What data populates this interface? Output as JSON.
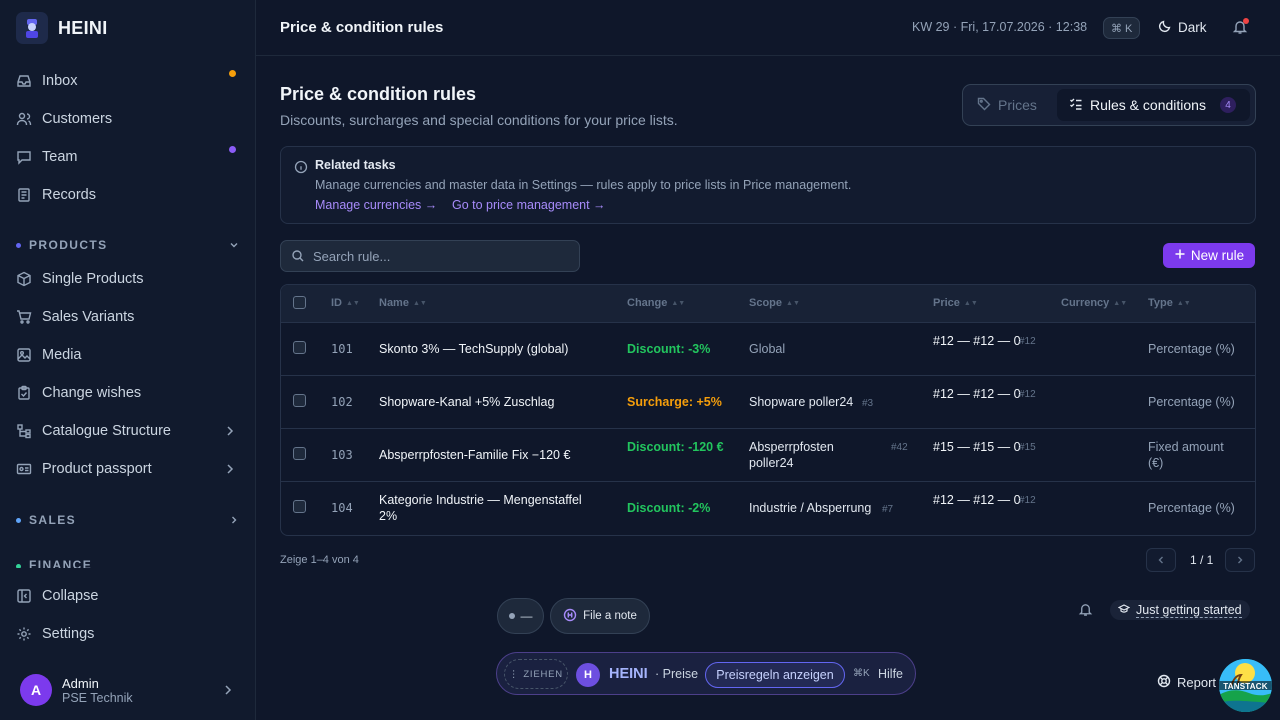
{
  "brand": {
    "name": "HEINI"
  },
  "nav": {
    "inbox": "Inbox",
    "customers": "Customers",
    "team": "Team",
    "records": "Records",
    "products_section": "PRODUCTS",
    "single_products": "Single Products",
    "sales_variants": "Sales Variants",
    "media": "Media",
    "change_wishes": "Change wishes",
    "catalogue_structure": "Catalogue Structure",
    "product_passport": "Product passport",
    "sales_section": "SALES",
    "finance_section": "FINANCE",
    "collapse": "Collapse",
    "settings": "Settings",
    "status_colors": {
      "inbox": "#f59e0b",
      "team": "#8b5cf6"
    }
  },
  "user": {
    "initial": "A",
    "name": "Admin",
    "org": "PSE Technik"
  },
  "topbar": {
    "title": "Price & condition rules",
    "datetime": "KW 29 · Fri, 17.07.2026 · 12:38",
    "shortcut": "⌘ K",
    "theme_label": "Dark"
  },
  "page": {
    "title": "Price & condition rules",
    "subtitle": "Discounts, surcharges and special conditions for your price lists."
  },
  "tabs": {
    "prices": "Prices",
    "rules": "Rules & conditions",
    "rules_count": "4"
  },
  "info": {
    "title": "Related tasks",
    "text": "Manage currencies and master data in Settings — rules apply to price lists in Price management.",
    "link1": "Manage currencies →",
    "link2": "Go to price management →"
  },
  "search": {
    "placeholder": "Search rule..."
  },
  "actions": {
    "new_rule": "New rule"
  },
  "table": {
    "columns": {
      "id": "ID",
      "name": "Name",
      "change": "Change",
      "scope": "Scope",
      "price": "Price",
      "currency": "Currency",
      "type": "Type"
    },
    "rows": [
      {
        "id": "101",
        "name": "Skonto 3% — TechSupply (global)",
        "change": "Discount: -3%",
        "change_kind": "discount",
        "scope": "Global",
        "scope_tag": "",
        "price": "#12 — #12 — 0",
        "price_tag": "#12",
        "currency": "",
        "type": "Percentage (%)"
      },
      {
        "id": "102",
        "name": "Shopware-Kanal +5% Zuschlag",
        "change": "Surcharge: +5%",
        "change_kind": "surcharge",
        "scope": "Shopware poller24",
        "scope_tag": "#3",
        "price": "#12 — #12 — 0",
        "price_tag": "#12",
        "currency": "",
        "type": "Percentage (%)"
      },
      {
        "id": "103",
        "name": "Absperrpfosten-Familie Fix −120 €",
        "change": "Discount: -120 €",
        "change_kind": "discount",
        "scope": "Absperrpfosten poller24",
        "scope_tag": "#42",
        "price": "#15 — #15 — 0",
        "price_tag": "#15",
        "currency": "",
        "type": "Fixed amount (€)"
      },
      {
        "id": "104",
        "name": "Kategorie Industrie — Mengenstaffel 2%",
        "change": "Discount: -2%",
        "change_kind": "discount",
        "scope": "Industrie / Absperrung",
        "scope_tag": "#7",
        "price": "#12 — #12 — 0",
        "price_tag": "#12",
        "currency": "",
        "type": "Percentage (%)"
      }
    ]
  },
  "pagination": {
    "info": "Zeige 1–4 von 4",
    "pages": "1 / 1"
  },
  "floating": {
    "dash": "—",
    "file_note": "File a note",
    "getting_started": "Just getting started"
  },
  "dock": {
    "drag": "ZIEHEN",
    "initial": "H",
    "name": "HEINI",
    "context": "· Preise",
    "action": "Preisregeln anzeigen",
    "kbd": "⌘K",
    "help": "Hilfe"
  },
  "report": {
    "label": "Report",
    "logo_text": "TANSTACK"
  },
  "colors": {
    "accent": "#7c3aed",
    "discount": "#22c55e",
    "surcharge": "#f59e0b",
    "background": "#0f172a"
  }
}
